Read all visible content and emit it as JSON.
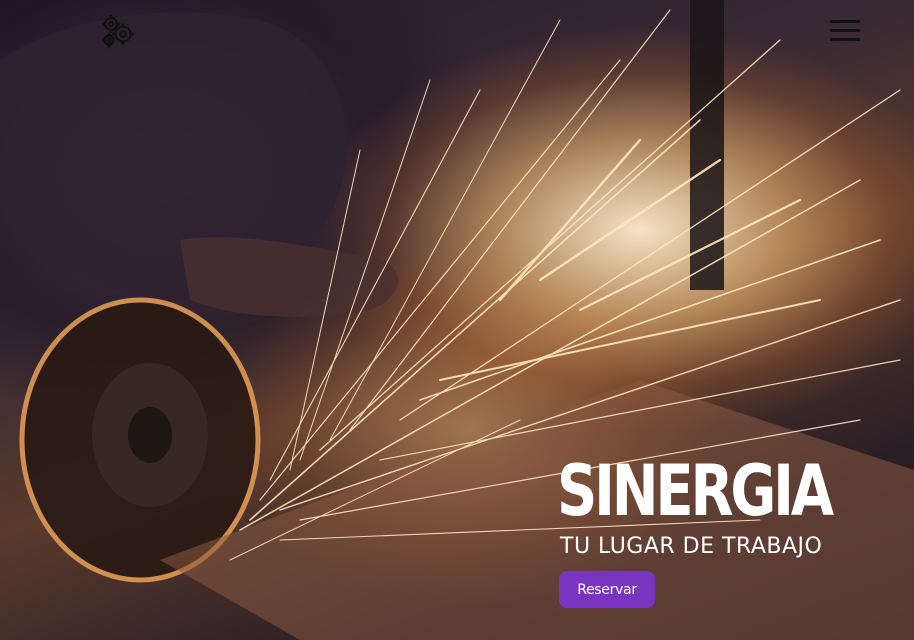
{
  "header": {
    "logo_icon": "gears-icon",
    "menu_icon": "hamburger-menu-icon"
  },
  "hero": {
    "title": "SINERGIA",
    "subtitle": "TU LUGAR DE TRABAJO",
    "cta_label": "Reservar",
    "cta_color": "#7a35c0"
  }
}
